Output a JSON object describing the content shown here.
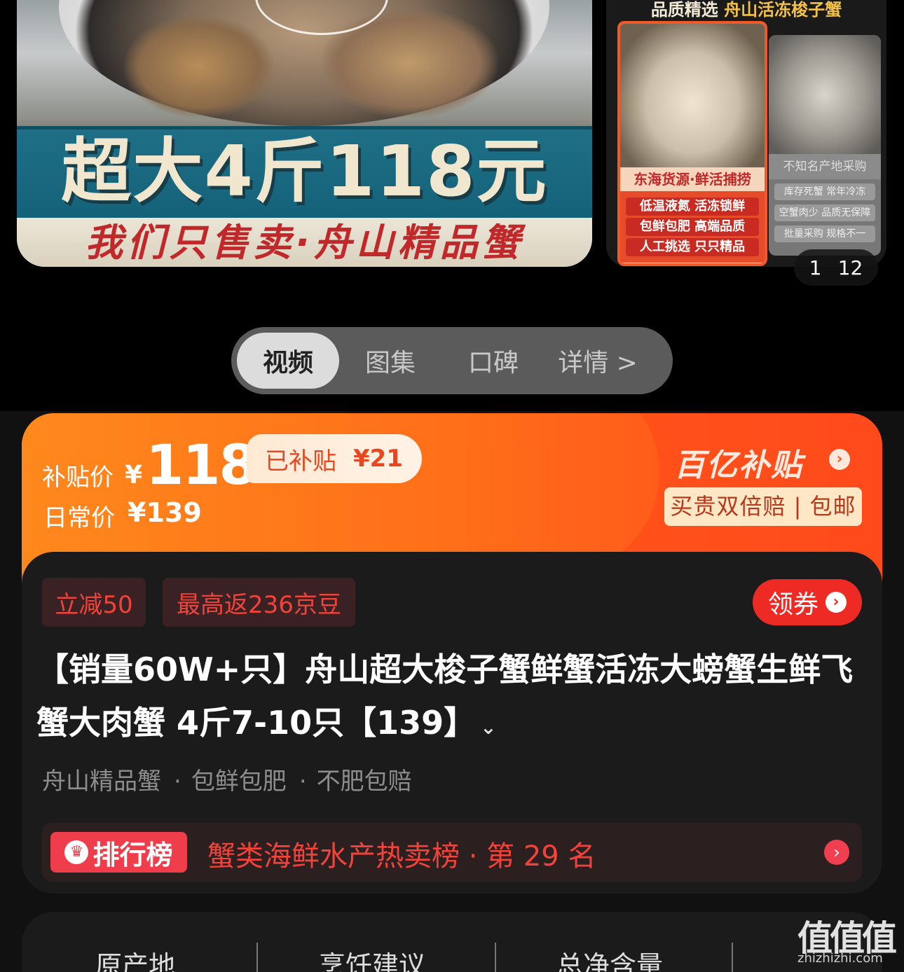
{
  "gallery": {
    "main_headline": "超大4斤118元",
    "main_subline": "我们只售卖·舟山精品蟹",
    "side_title_prefix": "品质精选",
    "side_title_highlight": "舟山活冻梭子蟹",
    "good_panel": {
      "caption": "东海货源·鲜活捕捞",
      "rows": [
        "低温液氮 活冻锁鲜",
        "包鲜包肥 高端品质",
        "人工挑选 只只精品"
      ]
    },
    "bad_panel": {
      "caption": "不知名产地采购",
      "rows": [
        "库存死蟹 常年冷冻",
        "空蟹肉少 品质无保障",
        "批量采购 规格不一"
      ]
    },
    "pager": {
      "current": "1",
      "total": "12"
    }
  },
  "tabs": [
    "视频",
    "图集",
    "口碑",
    "详情 >"
  ],
  "price": {
    "subsidy_label": "补贴价",
    "currency": "¥",
    "subsidy_price": "118",
    "subsidy_badge_label": "已补贴",
    "subsidy_badge_amount": "¥21",
    "daily_label": "日常价",
    "daily_price": "¥139",
    "brand": "百亿补贴",
    "guarantee": "买贵双倍赔 | 包邮"
  },
  "promos": [
    "立减50",
    "最高返236京豆"
  ],
  "coupon_label": "领券",
  "title": "【销量60W+只】舟山超大梭子蟹鲜蟹活冻大螃蟹生鲜飞蟹大肉蟹 4斤7-10只【139】",
  "tags": [
    "舟山精品蟹",
    "包鲜包肥",
    "不肥包赔"
  ],
  "ranking": {
    "badge": "排行榜",
    "text": "蟹类海鲜水产热卖榜 · 第 29 名"
  },
  "specs": [
    "原产地",
    "烹饪建议",
    "总净含量"
  ],
  "watermark": {
    "main": "值值值",
    "sub": "zhizhizhi.com"
  },
  "colors": {
    "accent_orange": "#ff5a1d",
    "promo_red": "#f2433b",
    "coupon_red": "#ee2a24",
    "rank_pink": "#ef3d4c"
  }
}
